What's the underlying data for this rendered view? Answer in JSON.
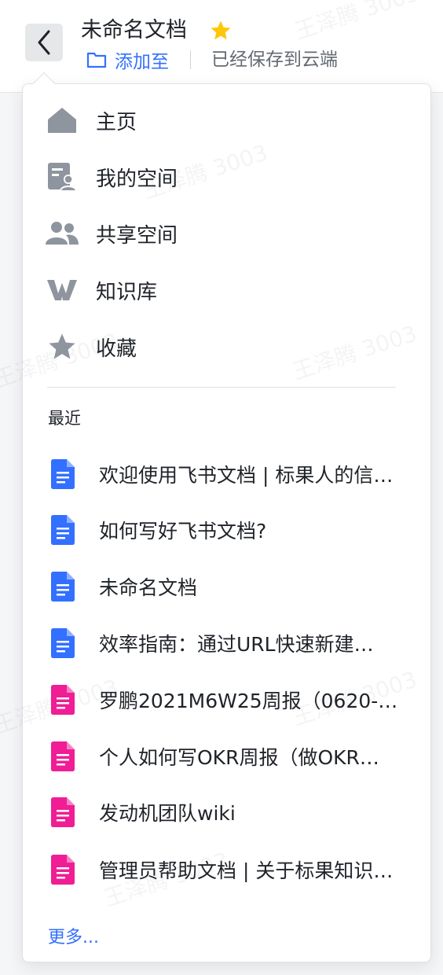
{
  "header": {
    "title": "未命名文档",
    "add_to_label": "添加至",
    "saved_status": "已经保存到云端",
    "star_color": "#ffc60a"
  },
  "watermark": "王泽腾 3003",
  "nav": [
    {
      "label": "主页",
      "icon": "home-icon"
    },
    {
      "label": "我的空间",
      "icon": "my-space-icon"
    },
    {
      "label": "共享空间",
      "icon": "shared-space-icon"
    },
    {
      "label": "知识库",
      "icon": "wiki-icon"
    },
    {
      "label": "收藏",
      "icon": "star-icon"
    }
  ],
  "recent": {
    "title": "最近",
    "items": [
      {
        "label": "欢迎使用飞书文档 | 标果人的信…",
        "color": "#3370ff"
      },
      {
        "label": "如何写好飞书文档?",
        "color": "#3370ff"
      },
      {
        "label": "未命名文档",
        "color": "#3370ff"
      },
      {
        "label": "效率指南：通过URL快速新建…",
        "color": "#3370ff"
      },
      {
        "label": "罗鹏2021M6W25周报（0620-…",
        "color": "#f01d94"
      },
      {
        "label": "个人如何写OKR周报（做OKR…",
        "color": "#f01d94"
      },
      {
        "label": "发动机团队wiki",
        "color": "#f01d94"
      },
      {
        "label": "管理员帮助文档 | 关于标果知识…",
        "color": "#f01d94"
      }
    ],
    "more_label": "更多..."
  }
}
